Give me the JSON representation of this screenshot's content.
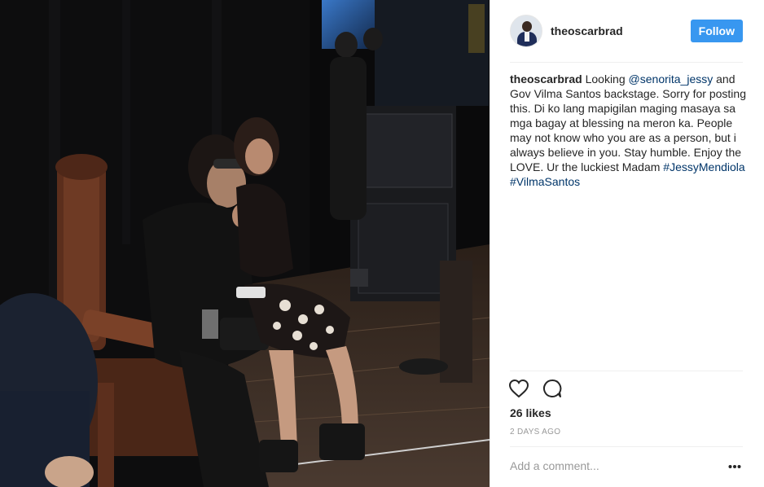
{
  "post": {
    "username": "theoscarbrad",
    "follow_label": "Follow",
    "caption": {
      "username": "theoscarbrad",
      "text_1": " Looking ",
      "mention": "@senorita_jessy",
      "text_2": " and Gov Vilma Santos backstage. Sorry for posting this. Di ko lang mapigilan maging masaya sa mga bagay at blessing na meron ka. People may not know who you are as a person, but i always believe in you. Stay humble. Enjoy the LOVE. Ur the luckiest Madam ",
      "hashtag_1": "#JessyMendiola",
      "text_3": " ",
      "hashtag_2": "#VilmaSantos"
    },
    "likes": "26 likes",
    "timestamp": "2 DAYS AGO",
    "comment_placeholder": "Add a comment...",
    "icons": {
      "like": "heart-icon",
      "comment": "comment-icon",
      "more": "more-options-icon"
    },
    "colors": {
      "follow_button": "#3897f0",
      "link": "#003569",
      "muted": "#999999"
    }
  }
}
